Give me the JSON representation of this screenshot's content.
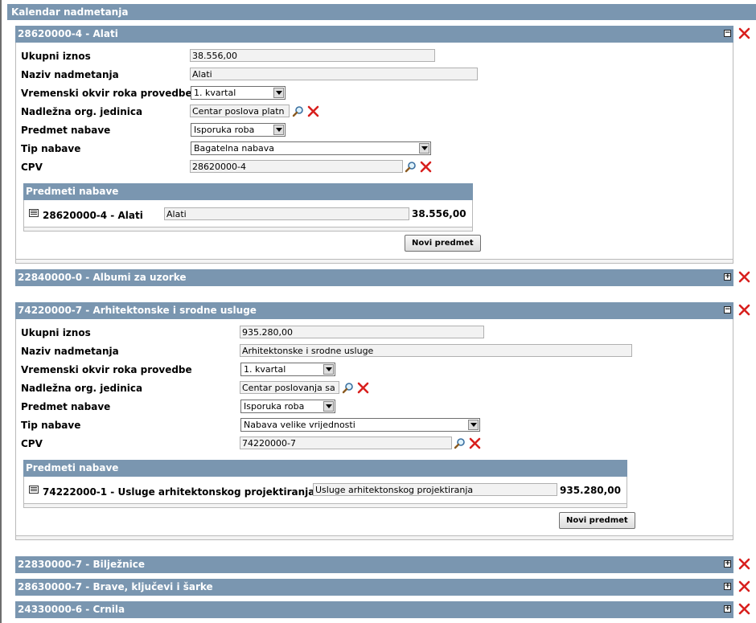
{
  "app": {
    "title": "Kalendar nadmetanja"
  },
  "labels": {
    "ukupni_iznos": "Ukupni iznos",
    "naziv_nadmetanja": "Naziv nadmetanja",
    "vremenski_okvir": "Vremenski okvir roka provedbe",
    "nadlezna_org": "Nadležna org. jedinica",
    "predmet_nabave": "Predmet nabave",
    "tip_nabave": "Tip nabave",
    "cpv": "CPV",
    "predmeti_nabave": "Predmeti nabave",
    "novi_predmet": "Novi predmet"
  },
  "icons": {
    "toggle_collapse": "minus-icon",
    "toggle_expand": "plus-icon",
    "remove": "close-icon",
    "search": "search-icon",
    "row": "table-row-icon"
  },
  "colors": {
    "header_bg": "#7a96b0",
    "remove_red": "#d8201e"
  },
  "panels": [
    {
      "title": "28620000-4 - Alati",
      "expanded": true,
      "ukupni_iznos": "38.556,00",
      "naziv": "Alati",
      "vremenski_okvir": "1. kvartal",
      "nadlezna_org": "Centar poslova platn",
      "predmet_nabave": "Isporuka roba",
      "tip_nabave": "Bagatelna nabava",
      "cpv": "28620000-4",
      "items": [
        {
          "code": "28620000-4 - Alati",
          "description": "Alati",
          "amount": "38.556,00"
        }
      ]
    },
    {
      "title": "22840000-0 - Albumi za uzorke",
      "expanded": false
    },
    {
      "title": "74220000-7 - Arhitektonske i srodne usluge",
      "expanded": true,
      "ukupni_iznos": "935.280,00",
      "naziv": "Arhitektonske i srodne usluge",
      "vremenski_okvir": "1. kvartal",
      "nadlezna_org": "Centar poslovanja sa",
      "predmet_nabave": "Isporuka roba",
      "tip_nabave": "Nabava velike vrijednosti",
      "cpv": "74220000-7",
      "items": [
        {
          "code": "74222000-1 - Usluge arhitektonskog projektiranja",
          "description": "Usluge arhitektonskog projektiranja",
          "amount": "935.280,00"
        }
      ]
    },
    {
      "title": "22830000-7 - Bilježnice",
      "expanded": false
    },
    {
      "title": "28630000-7 - Brave, ključevi i šarke",
      "expanded": false
    },
    {
      "title": "24330000-6 - Crnila",
      "expanded": false
    }
  ]
}
